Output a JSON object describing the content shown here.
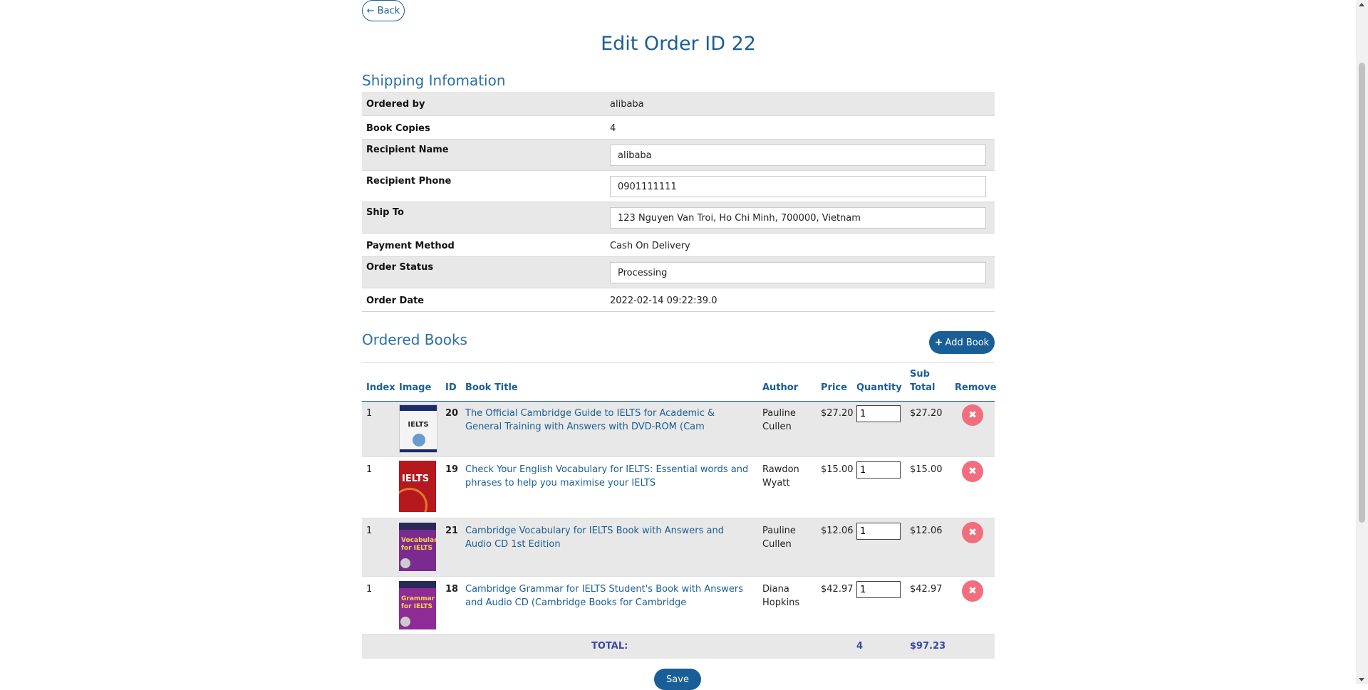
{
  "nav": {
    "back_label": "Back"
  },
  "page": {
    "title": "Edit Order ID 22"
  },
  "shipping": {
    "section_title": "Shipping Infomation",
    "ordered_by_label": "Ordered by",
    "ordered_by": "alibaba",
    "book_copies_label": "Book Copies",
    "book_copies": "4",
    "recipient_name_label": "Recipient Name",
    "recipient_name": "alibaba",
    "recipient_phone_label": "Recipient Phone",
    "recipient_phone": "0901111111",
    "ship_to_label": "Ship To",
    "ship_to": "123 Nguyen Van Troi, Ho Chi Minh, 700000, Vietnam",
    "payment_method_label": "Payment Method",
    "payment_method": "Cash On Delivery",
    "order_status_label": "Order Status",
    "order_status": "Processing",
    "order_date_label": "Order Date",
    "order_date": "2022-02-14 09:22:39.0"
  },
  "ordered_books": {
    "section_title": "Ordered Books",
    "add_book_label": "Add Book",
    "columns": {
      "index": "Index",
      "image": "Image",
      "id": "ID",
      "title": "Book Title",
      "author": "Author",
      "price": "Price",
      "quantity": "Quantity",
      "subtotal_1": "Sub",
      "subtotal_2": "Total",
      "remove": "Remove"
    },
    "rows": [
      {
        "index": "1",
        "id": "20",
        "title": "The Official Cambridge Guide to IELTS for Academic & General Training with Answers with DVD-ROM (Cam",
        "author": "Pauline Cullen",
        "price": "$27.20",
        "quantity": "1",
        "subtotal": "$27.20",
        "cover_text": "IELTS",
        "cover_color": "#f4f4f4"
      },
      {
        "index": "1",
        "id": "19",
        "title": "Check Your English Vocabulary for IELTS: Essential words and phrases to help you maximise your IELTS",
        "author": "Rawdon Wyatt",
        "price": "$15.00",
        "quantity": "1",
        "subtotal": "$15.00",
        "cover_text": "IELTS",
        "cover_color": "#b5181d"
      },
      {
        "index": "1",
        "id": "21",
        "title": "Cambridge Vocabulary for IELTS Book with Answers and Audio CD 1st Edition",
        "author": "Pauline Cullen",
        "price": "$12.06",
        "quantity": "1",
        "subtotal": "$12.06",
        "cover_text": "Vocabulary for IELTS",
        "cover_color": "#7b2b8f"
      },
      {
        "index": "1",
        "id": "18",
        "title": "Cambridge Grammar for IELTS Student's Book with Answers and Audio CD (Cambridge Books for Cambridge",
        "author": "Diana Hopkins",
        "price": "$42.97",
        "quantity": "1",
        "subtotal": "$42.97",
        "cover_text": "Grammar for IELTS",
        "cover_color": "#8e2b96"
      }
    ],
    "total_label": "TOTAL:",
    "total_quantity": "4",
    "total_amount": "$97.23"
  },
  "actions": {
    "save_label": "Save"
  },
  "colors": {
    "primary": "#1a5e97",
    "remove": "#f26d7d",
    "total": "#3a48a8",
    "row_shade": "#e8e8e8"
  }
}
